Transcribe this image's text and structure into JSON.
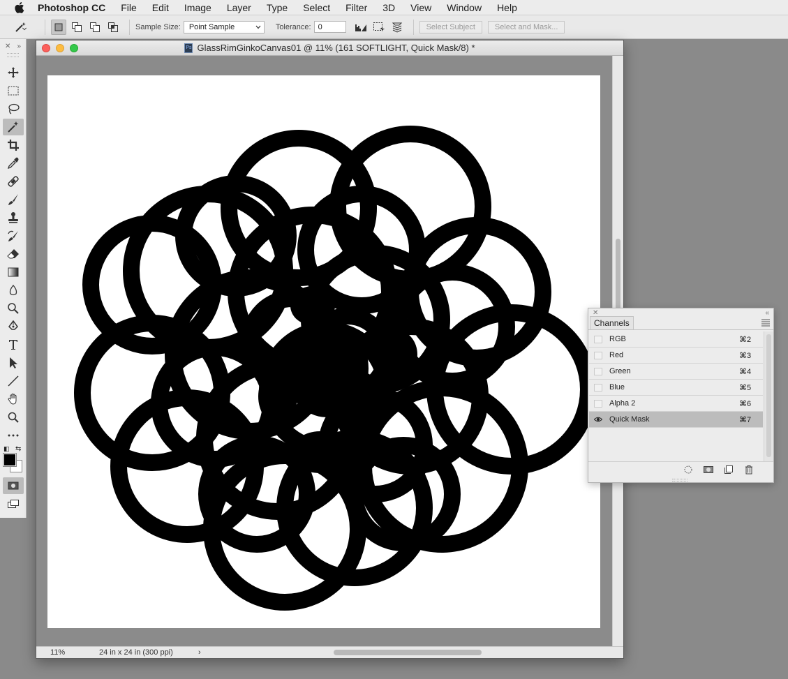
{
  "menubar": {
    "app_name": "Photoshop CC",
    "items": [
      "File",
      "Edit",
      "Image",
      "Layer",
      "Type",
      "Select",
      "Filter",
      "3D",
      "View",
      "Window",
      "Help"
    ]
  },
  "options": {
    "sample_size_label": "Sample Size:",
    "sample_size_value": "Point Sample",
    "tolerance_label": "Tolerance:",
    "tolerance_value": "0",
    "select_subject": "Select Subject",
    "select_and_mask": "Select and Mask..."
  },
  "document": {
    "title": "GlassRimGinkoCanvas01 @ 11% (161 SOFTLIGHT, Quick Mask/8) *",
    "doc_icon": "Ps",
    "zoom": "11%",
    "doc_info": "24 in x 24 in (300 ppi)",
    "status_arrow": "›"
  },
  "channels_panel": {
    "tab": "Channels",
    "rows": [
      {
        "name": "RGB",
        "shortcut": "⌘2",
        "visible": false,
        "selected": false
      },
      {
        "name": "Red",
        "shortcut": "⌘3",
        "visible": false,
        "selected": false
      },
      {
        "name": "Green",
        "shortcut": "⌘4",
        "visible": false,
        "selected": false
      },
      {
        "name": "Blue",
        "shortcut": "⌘5",
        "visible": false,
        "selected": false
      },
      {
        "name": "Alpha 2",
        "shortcut": "⌘6",
        "visible": false,
        "selected": false
      },
      {
        "name": "Quick Mask",
        "shortcut": "⌘7",
        "visible": true,
        "selected": true
      }
    ]
  },
  "colors": {
    "foreground": "#000000",
    "background": "#ffffff",
    "selected_row": "#bcbcbc"
  },
  "tools": [
    "move-tool-icon",
    "marquee-tool-icon",
    "lasso-tool-icon",
    "magic-wand-tool-icon",
    "crop-tool-icon",
    "eyedropper-tool-icon",
    "healing-brush-tool-icon",
    "brush-tool-icon",
    "clone-stamp-tool-icon",
    "history-brush-tool-icon",
    "eraser-tool-icon",
    "gradient-tool-icon",
    "blur-tool-icon",
    "dodge-tool-icon",
    "pen-tool-icon",
    "type-tool-icon",
    "path-selection-tool-icon",
    "line-tool-icon",
    "hand-tool-icon",
    "zoom-tool-icon",
    "more-tools-icon"
  ]
}
